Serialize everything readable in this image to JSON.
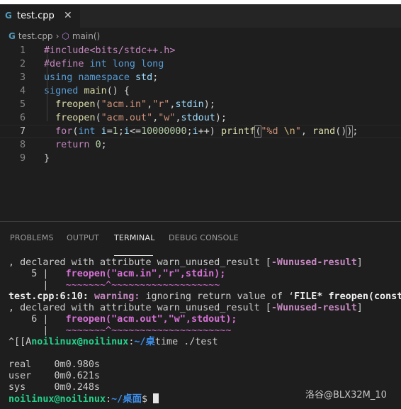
{
  "tab": {
    "icon": "G",
    "label": "test.cpp",
    "close": "✕"
  },
  "breadcrumb": {
    "file": "test.cpp",
    "sep": "›",
    "symbol": "main()"
  },
  "editor": {
    "line_numbers": [
      "1",
      "2",
      "3",
      "4",
      "5",
      "6",
      "7",
      "8",
      "9"
    ],
    "active_line": 7,
    "lines": [
      [
        [
          "#include<bits/stdc++.h>",
          "dir"
        ]
      ],
      [
        [
          "#define ",
          "dir"
        ],
        [
          "int long long",
          "kw"
        ]
      ],
      [
        [
          "using ",
          "kw"
        ],
        [
          "namespace ",
          "kw"
        ],
        [
          "std",
          "var"
        ],
        [
          ";",
          "pun"
        ]
      ],
      [
        [
          "signed ",
          "kw"
        ],
        [
          "main",
          "fn"
        ],
        [
          "() {",
          "pun"
        ]
      ],
      [
        [
          "  ",
          "pun"
        ],
        [
          "freopen",
          "fn"
        ],
        [
          "(",
          "pun"
        ],
        [
          "\"acm.in\"",
          "str"
        ],
        [
          ",",
          "pun"
        ],
        [
          "\"r\"",
          "str"
        ],
        [
          ",",
          "pun"
        ],
        [
          "stdin",
          "var"
        ],
        [
          ");",
          "pun"
        ]
      ],
      [
        [
          "  ",
          "pun"
        ],
        [
          "freopen",
          "fn"
        ],
        [
          "(",
          "pun"
        ],
        [
          "\"acm.out\"",
          "str"
        ],
        [
          ",",
          "pun"
        ],
        [
          "\"w\"",
          "str"
        ],
        [
          ",",
          "pun"
        ],
        [
          "stdout",
          "var"
        ],
        [
          ");",
          "pun"
        ]
      ],
      [
        [
          "  ",
          "pun"
        ],
        [
          "for",
          "ctl"
        ],
        [
          "(",
          "pun"
        ],
        [
          "int ",
          "type"
        ],
        [
          "i",
          "var"
        ],
        [
          "=",
          "pun"
        ],
        [
          "1",
          "num"
        ],
        [
          ";",
          "pun"
        ],
        [
          "i",
          "var"
        ],
        [
          "<=",
          "pun"
        ],
        [
          "10000000",
          "num"
        ],
        [
          ";",
          "pun"
        ],
        [
          "i",
          "var"
        ],
        [
          "++) ",
          "pun"
        ],
        [
          "printf",
          "fn"
        ],
        [
          "(",
          "bracket"
        ],
        [
          "\"%d ",
          "str"
        ],
        [
          "\\n",
          "esc"
        ],
        [
          "\"",
          "str"
        ],
        [
          ", ",
          "pun"
        ],
        [
          "rand",
          "fn"
        ],
        [
          "()",
          "pun"
        ],
        [
          ")",
          "bracket"
        ],
        [
          ";",
          "pun"
        ]
      ],
      [
        [
          "  ",
          "pun"
        ],
        [
          "return ",
          "ctl"
        ],
        [
          "0",
          "num"
        ],
        [
          ";",
          "pun"
        ]
      ],
      [
        [
          "}",
          "pun"
        ]
      ]
    ]
  },
  "panel": {
    "tabs": [
      "PROBLEMS",
      "OUTPUT",
      "TERMINAL",
      "DEBUG CONSOLE"
    ],
    "active_tab": "TERMINAL"
  },
  "terminal": {
    "lines": [
      [
        [
          ", declared with attribute warn_unused_result [",
          ""
        ],
        [
          "-Wunused-result",
          "warn"
        ],
        [
          "]",
          ""
        ]
      ],
      [
        [
          "    5 |   ",
          ""
        ],
        [
          "freopen(\"acm.in\",\"r\",stdin);",
          "magb"
        ]
      ],
      [
        [
          "      |   ",
          ""
        ],
        [
          "~~~~~~~^~~~~~~~~~~~~~~~~~~~",
          "mag"
        ]
      ],
      [
        [
          "test.cpp:6:10: ",
          "bold"
        ],
        [
          "warning: ",
          "warn"
        ],
        [
          "ignoring return value of ‘",
          ""
        ],
        [
          "FILE* freopen(const",
          "bold"
        ]
      ],
      [
        [
          ", declared with attribute warn_unused_result [",
          ""
        ],
        [
          "-Wunused-result",
          "warn"
        ],
        [
          "]",
          ""
        ]
      ],
      [
        [
          "    6 |   ",
          ""
        ],
        [
          "freopen(\"acm.out\",\"w\",stdout);",
          "magb"
        ]
      ],
      [
        [
          "      |   ",
          ""
        ],
        [
          "~~~~~~~^~~~~~~~~~~~~~~~~~~~~~",
          "mag"
        ]
      ],
      [
        [
          "^[[A",
          ""
        ],
        [
          "noilinux@noilinux",
          "green"
        ],
        [
          ":",
          ""
        ],
        [
          "~/桌",
          "blue"
        ],
        [
          "time ./test",
          ""
        ]
      ],
      [
        [
          "",
          ""
        ]
      ],
      [
        [
          "real    0m0.980s",
          ""
        ]
      ],
      [
        [
          "user    0m0.621s",
          ""
        ]
      ],
      [
        [
          "sys     0m0.248s",
          ""
        ]
      ],
      [
        [
          "noilinux@noilinux",
          "green"
        ],
        [
          ":",
          ""
        ],
        [
          "~/桌面",
          "blue"
        ],
        [
          "$ ",
          ""
        ],
        [
          "",
          "cursor"
        ]
      ]
    ]
  },
  "watermark": "洛谷@BLX32M_10",
  "colors": {
    "editor_bg": "#1e1e1e",
    "tabbar_bg": "#252526",
    "keyword": "#569cd6",
    "string": "#ce9178",
    "function": "#dcdcaa"
  }
}
